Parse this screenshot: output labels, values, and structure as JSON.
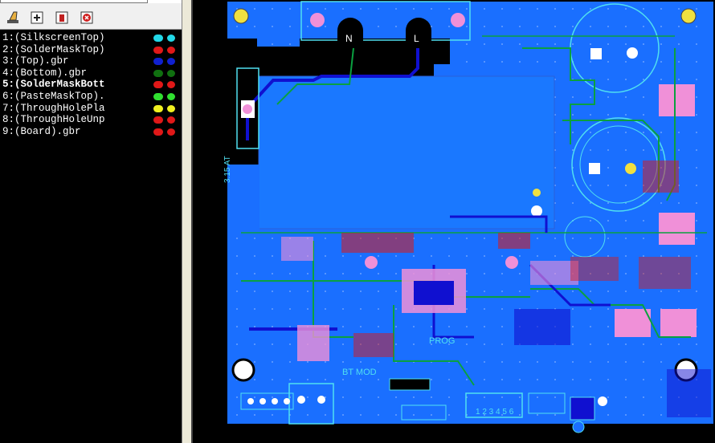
{
  "layers_panel": {
    "layers": [
      {
        "label": "1:(SilkscreenTop)",
        "color1": "#22d8e8",
        "color2": "#22d8e8",
        "active": false
      },
      {
        "label": "2:(SolderMaskTop)",
        "color1": "#e01818",
        "color2": "#e01818",
        "active": false
      },
      {
        "label": "3:(Top).gbr",
        "color1": "#1020d0",
        "color2": "#1020d0",
        "active": false
      },
      {
        "label": "4:(Bottom).gbr",
        "color1": "#107010",
        "color2": "#107010",
        "active": false
      },
      {
        "label": "5:(SolderMaskBott",
        "color1": "#e01818",
        "color2": "#e01818",
        "active": true
      },
      {
        "label": "6:(PasteMaskTop).",
        "color1": "#30e030",
        "color2": "#30e030",
        "active": false
      },
      {
        "label": "7:(ThroughHolePla",
        "color1": "#f0f020",
        "color2": "#f0f020",
        "active": false
      },
      {
        "label": "8:(ThroughHoleUnp",
        "color1": "#e01818",
        "color2": "#e01818",
        "active": false
      },
      {
        "label": "9:(Board).gbr",
        "color1": "#e01818",
        "color2": "#e01818",
        "active": false
      }
    ]
  },
  "toolbar": {
    "icons": [
      "eraser-icon",
      "add-layer-icon",
      "layer-properties-icon",
      "delete-layer-icon"
    ]
  },
  "pcb_labels": {
    "n": "N",
    "l": "L",
    "bt_mod": "BT MOD",
    "prog": "PROG",
    "side_rev": "3.15 AT",
    "digits": "1 2 3 4 5 6"
  },
  "colors": {
    "board_blue": "#1a6fff",
    "copper_blue": "#1010d0",
    "silk_cyan": "#50e0f0",
    "green_trace": "#0aa040",
    "pad_pink": "#f090d8",
    "pad_red": "#d81818",
    "mount_yellow": "#f0e040"
  }
}
